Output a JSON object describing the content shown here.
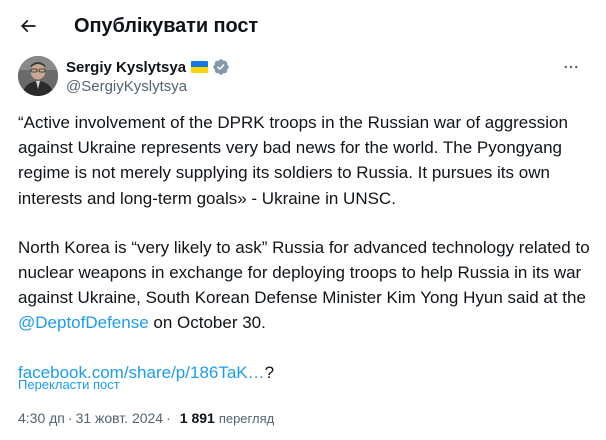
{
  "header": {
    "title": "Опублікувати пост",
    "back_icon": "arrow-left-icon"
  },
  "author": {
    "name": "Sergiy Kyslytsya",
    "handle": "@SergiyKyslytsya",
    "flag": "ukraine-flag-icon",
    "verified_icon": "verified-badge-icon",
    "verified_color": "#829aab"
  },
  "tweet": {
    "paragraph1": "“Active involvement of the DPRK troops in the Russian war of aggression against Ukraine represents very bad news for the world. The Pyongyang regime is not merely supplying its soldiers to Russia. It pursues its own interests and long-term goals» - Ukraine in UNSC.",
    "paragraph2_before": "North Korea is “very likely to ask” Russia for advanced technology related to nuclear weapons in exchange for deploying troops to help Russia in its war against Ukraine, South Korean Defense Minister Kim Yong Hyun said at the ",
    "paragraph2_mention": "@DeptofDefense",
    "paragraph2_after": " on October 30.",
    "link": "facebook.com/share/p/186TaK…",
    "link_suffix": "?"
  },
  "translate_label": "Перекласти пост",
  "meta": {
    "time": "4:30 дп",
    "separator": "·",
    "date": "31 жовт. 2024",
    "views_count": "1 891",
    "views_label": "перегляд"
  },
  "colors": {
    "accent": "#1d9bf0",
    "text": "#0f1419",
    "secondary": "#536471"
  }
}
